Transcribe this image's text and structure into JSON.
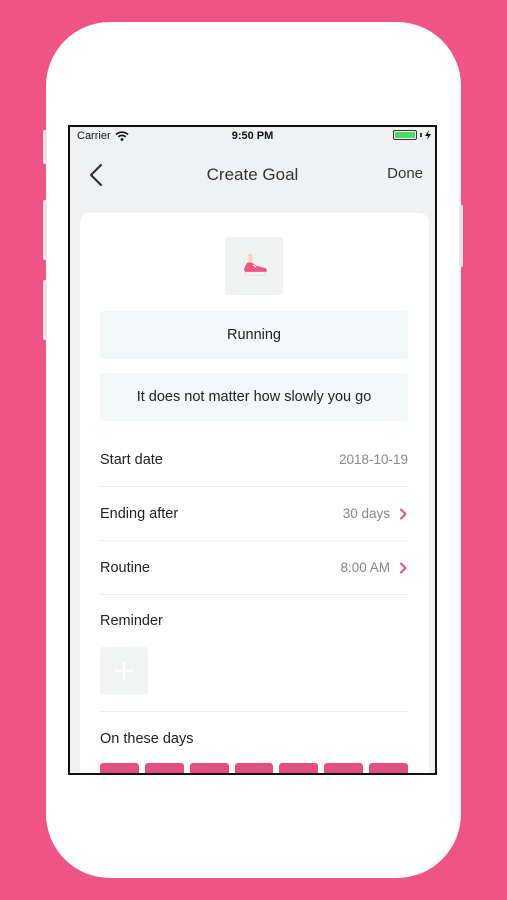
{
  "status_bar": {
    "carrier": "Carrier",
    "time": "9:50 PM"
  },
  "nav": {
    "title": "Create Goal",
    "done_label": "Done"
  },
  "goal": {
    "icon": "running-shoe-icon",
    "name": "Running",
    "motto": "It does not matter how slowly you go"
  },
  "rows": {
    "start_date": {
      "label": "Start date",
      "value": "2018-10-19"
    },
    "ending_after": {
      "label": "Ending after",
      "value": "30 days"
    },
    "routine": {
      "label": "Routine",
      "value": "8:00 AM"
    }
  },
  "reminder": {
    "label": "Reminder"
  },
  "days": {
    "label": "On these days",
    "count": 7
  },
  "colors": {
    "background": "#EE5586",
    "accent": "#E2517C",
    "battery": "#4CD964"
  }
}
